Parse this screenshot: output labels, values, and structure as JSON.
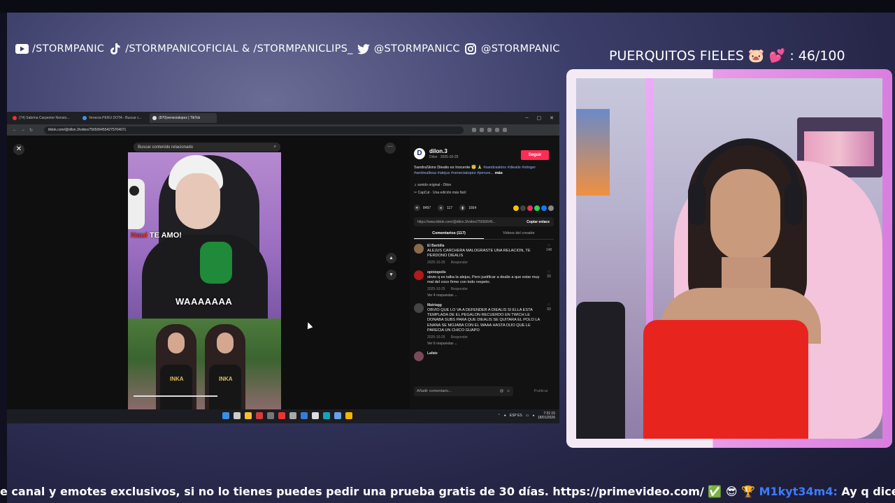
{
  "socials": [
    {
      "icon": "youtube-icon",
      "text": "/STORMPANIC"
    },
    {
      "icon": "tiktok-icon",
      "text": "/STORMPANICOFICIAL & /STORMPANICLIPS_"
    },
    {
      "icon": "twitter-icon",
      "text": "@STORMPANICC"
    },
    {
      "icon": "instagram-icon",
      "text": "@STORMPANIC"
    }
  ],
  "goal": {
    "text": "PUERQUITOS FIELES 🐷 💕 : 46/100"
  },
  "browser": {
    "tabs": [
      {
        "label": "(74) Sabrina Carpenter Nonsto...",
        "color": "#e33"
      },
      {
        "label": "Venecia PERU DOTA - Buscar c...",
        "color": "#4a90e2"
      },
      {
        "label": "(870)venecialopez | TikTok",
        "color": "#ddd"
      }
    ],
    "url": "tiktok.com/@dilon.3/video/7565064554275704071",
    "search_placeholder": "Buscar contenido relacionado",
    "video_overlay": {
      "te_amo_prefix": "Naui",
      "te_amo": "TE AMO!",
      "scream": "WAAAAAAA"
    },
    "brand_text": "INKA",
    "panel": {
      "avatar_letter": "D",
      "username": "dilon.3",
      "subline": "Dilon · 2025-10-25",
      "follow_label": "Seguir",
      "description": "SandraSkins Diealis es Inocente 😇 🙏",
      "tags": "#sandraskins #diealis #stinger #andreallosa #alejus #venecialopez #perure...",
      "more_label": "más",
      "sound": "♫  sonido original - Dilon",
      "capcut": "✂  CapCut · Una edición más fácil",
      "likes": "8497",
      "comments_count": "117",
      "saves": "1664",
      "link": "https://www.tiktok.com/@dilon.3/video/75650645...",
      "copy_label": "Copiar enlace",
      "tab_comments": "Comentarios (117)",
      "tab_creator": "Videos del creador",
      "comments": [
        {
          "name": "El Barbilla",
          "text": "ALEJUS CARCHERA MALOGRASTE UNA RELACION, TE PERDONO DIEALIS",
          "date": "2025-10-25",
          "reply": "Responder",
          "likes": "148",
          "more": ""
        },
        {
          "name": "opiniopolis",
          "text": "obvio q es talka la alejus, Pero justificar a dealis a que estar muy mal del coco firme con todo respeto.",
          "date": "2025-10-25",
          "reply": "Responder",
          "likes": "20",
          "more": "Ver 4 respuestas ⌄"
        },
        {
          "name": "Matriagg",
          "text": "OBVIO QUE LO VA A DEFENDER A DIEALIS SI ELLA ESTA TEMPLADA DE EL PEGALON RECUERDO EN TWICH LE DONABA SUBS PARA QUE DIEALIS SE QUITARA EL POLO LA ENANA SE MOJABA CON EL WAAA HASTA DIJO QUE LE PARECIA UN CHICO GUAPO",
          "date": "2025-10-25",
          "reply": "Responder",
          "likes": "93",
          "more": "Ver 6 respuestas ⌄"
        },
        {
          "name": "Lafate",
          "text": "",
          "date": "",
          "reply": "",
          "likes": "",
          "more": ""
        }
      ],
      "add_comment": "Añadir comentario...",
      "publish": "Publicar"
    },
    "taskbar": {
      "lang": "ESP\nES",
      "time": "7:31:15",
      "date": "18/01/2026"
    }
  },
  "ticker": {
    "text": "e canal y emotes exclusivos, si no lo tienes puedes pedir una prueba gratis de 30 días. https://primevideo.com/ ✅ 😎 🏆 ",
    "user": "M1kyt34m4:",
    "message": " Ay q dice mi sandraxd"
  },
  "colors": {
    "follow": "#fe2c55",
    "chat_user": "#3c7cff",
    "cam_frame_pink": "#e79be8",
    "top_red": "#e8241f"
  }
}
